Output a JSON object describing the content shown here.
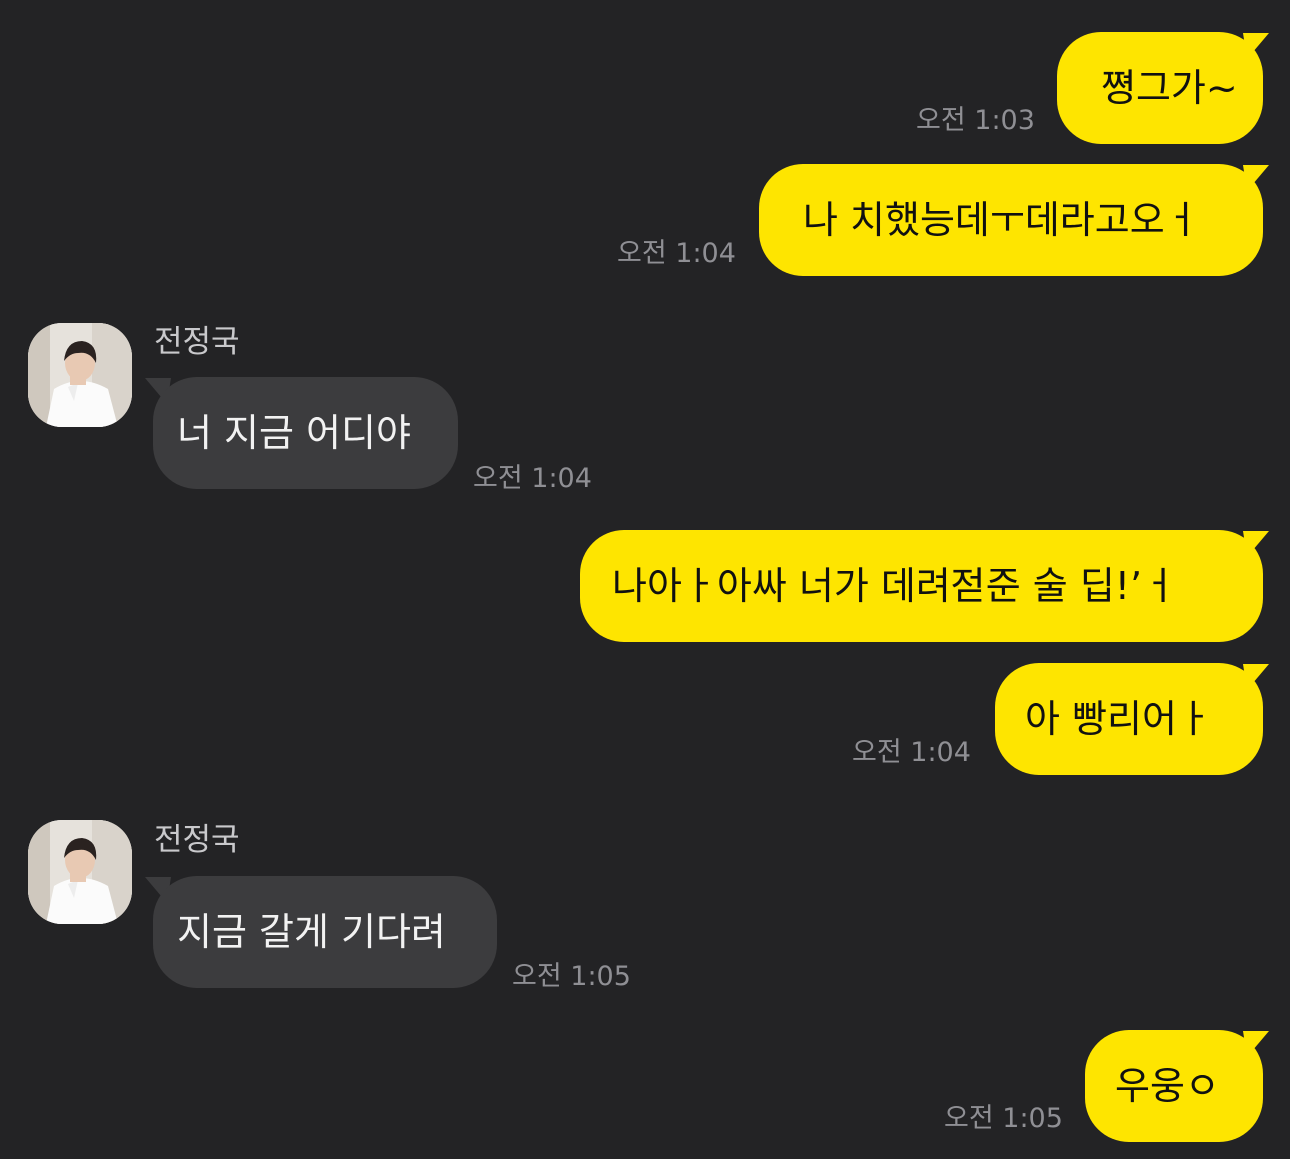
{
  "colors": {
    "background": "#232325",
    "my_bubble": "#FEE500",
    "their_bubble": "#3C3C3E",
    "timestamp": "#8F8F94"
  },
  "messages": [
    {
      "from": "me",
      "text": "쪙그가~",
      "time": "오전 1:03"
    },
    {
      "from": "me",
      "text": "나 치했능데ㅜ데라고오ㅓ",
      "time": "오전 1:04"
    },
    {
      "from": "other",
      "sender": "전정국",
      "avatar": "profile-photo",
      "text": "너 지금 어디야",
      "time": "오전 1:04"
    },
    {
      "from": "me",
      "text": "나아ㅏ아싸 너가 데려젇준 술 딥!’ㅓ",
      "time": ""
    },
    {
      "from": "me",
      "text": "아 빵리어ㅏ",
      "time": "오전 1:04"
    },
    {
      "from": "other",
      "sender": "전정국",
      "avatar": "profile-photo",
      "text": "지금 갈게 기다려",
      "time": "오전 1:05"
    },
    {
      "from": "me",
      "text": "우웅ㅇ",
      "time": "오전 1:05"
    }
  ]
}
